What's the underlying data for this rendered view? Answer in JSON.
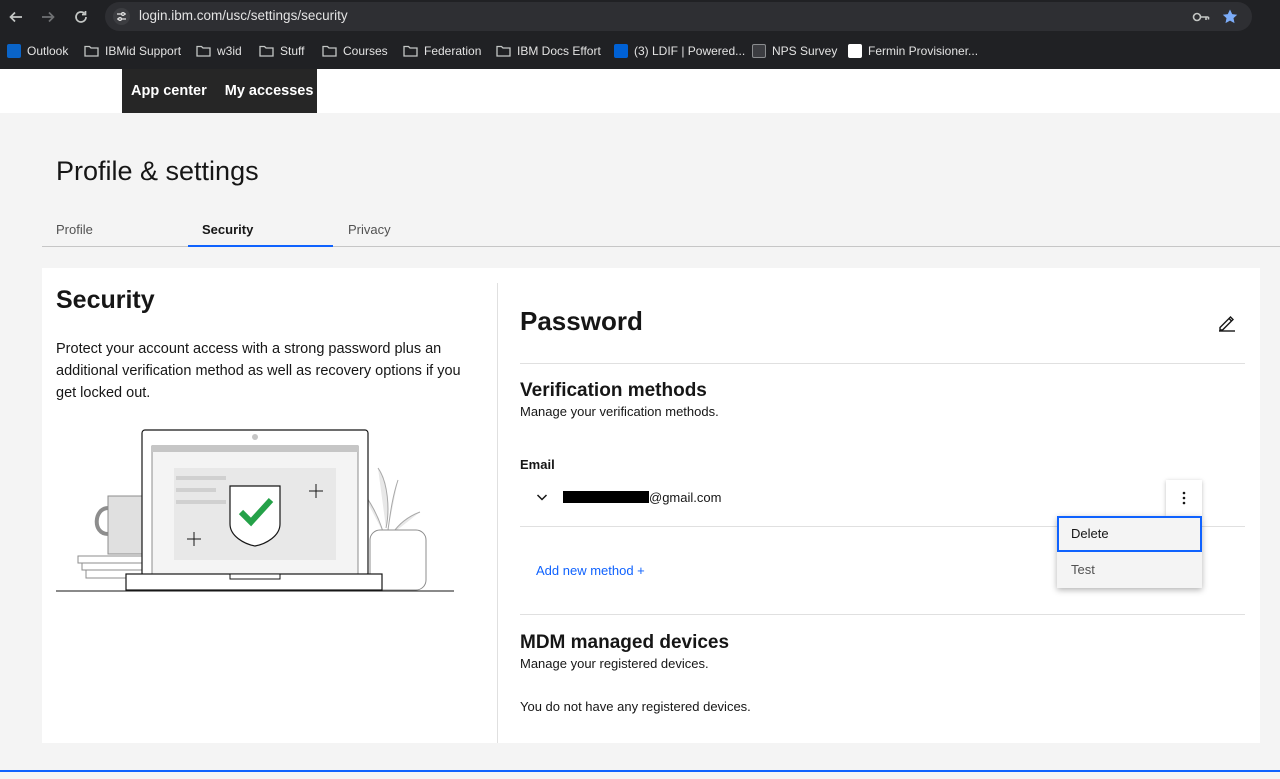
{
  "browser": {
    "url": "login.ibm.com/usc/settings/security",
    "bookmarks": [
      {
        "label": "Outlook",
        "icon": "outlook-icon"
      },
      {
        "label": "IBMid Support",
        "icon": "folder-icon"
      },
      {
        "label": "w3id",
        "icon": "folder-icon"
      },
      {
        "label": "Stuff",
        "icon": "folder-icon"
      },
      {
        "label": "Courses",
        "icon": "folder-icon"
      },
      {
        "label": "Federation",
        "icon": "folder-icon"
      },
      {
        "label": "IBM Docs Effort",
        "icon": "folder-icon"
      },
      {
        "label": "(3) LDIF | Powered...",
        "icon": "box-icon"
      },
      {
        "label": "NPS Survey",
        "icon": "survey-icon"
      },
      {
        "label": "Fermin Provisioner...",
        "icon": "doc-icon"
      }
    ]
  },
  "appbar": {
    "app_center": "App center",
    "my_accesses": "My accesses"
  },
  "page": {
    "title": "Profile & settings",
    "tabs": [
      {
        "label": "Profile"
      },
      {
        "label": "Security"
      },
      {
        "label": "Privacy"
      }
    ]
  },
  "security": {
    "heading": "Security",
    "description": "Protect your account access with a strong password plus an additional verification method as well as recovery options if you get locked out."
  },
  "password": {
    "heading": "Password"
  },
  "verification": {
    "heading": "Verification methods",
    "subtitle": "Manage your verification methods.",
    "email_label": "Email",
    "email_value": "@gmail.com",
    "add_method": "Add new method +",
    "menu": [
      {
        "label": "Delete"
      },
      {
        "label": "Test"
      }
    ]
  },
  "mdm": {
    "heading": "MDM managed devices",
    "subtitle": "Manage your registered devices.",
    "empty": "You do not have any registered devices."
  },
  "colors": {
    "accent": "#0f62fe",
    "nav_dark": "#262626",
    "chrome": "#202124"
  }
}
